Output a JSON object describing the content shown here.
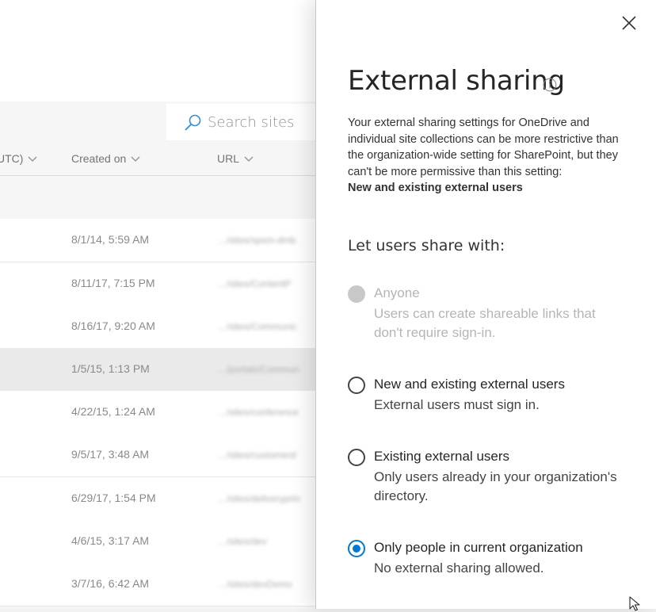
{
  "search": {
    "placeholder": "Search sites"
  },
  "table": {
    "columns": [
      {
        "label": "UTC)"
      },
      {
        "label": "Created on"
      },
      {
        "label": "URL"
      }
    ],
    "rows": [
      {
        "created": "8/1/14, 5:59 AM",
        "url": "…/sites/spsm-dmb"
      },
      {
        "created": "8/11/17, 7:15 PM",
        "url": "…/sites/ContentP"
      },
      {
        "created": "8/16/17, 9:20 AM",
        "url": "…/sites/Communic"
      },
      {
        "created": "1/5/15, 1:13 PM",
        "url": "…/portals/Commun"
      },
      {
        "created": "4/22/15, 1:24 AM",
        "url": "…/sites/conference"
      },
      {
        "created": "9/5/17, 3:48 AM",
        "url": "…/sites/customerd"
      },
      {
        "created": "6/29/17, 1:54 PM",
        "url": "…/sites/deliveryprin"
      },
      {
        "created": "4/6/15, 3:17 AM",
        "url": "…/sites/dev"
      },
      {
        "created": "3/7/16, 6:42 AM",
        "url": "…/sites/devDemo"
      }
    ]
  },
  "panel": {
    "title": "External sharing",
    "description": "Your external sharing settings for OneDrive and individual site collections can be more restrictive than the organization-wide setting for SharePoint, but they can't be more permissive than this setting:",
    "description_bold": "New and existing external users",
    "subhead": "Let users share with:",
    "options": [
      {
        "label": "Anyone",
        "desc": "Users can create shareable links that don't require sign-in."
      },
      {
        "label": "New and existing external users",
        "desc": "External users must sign in."
      },
      {
        "label": "Existing external users",
        "desc": "Only users already in your organization's directory."
      },
      {
        "label": "Only people in current organization",
        "desc": "No external sharing allowed."
      }
    ],
    "selected_option": "Only people in current organization",
    "disabled_option": "Anyone"
  },
  "colors": {
    "accent": "#0078d4",
    "disabled": "#c8c8c8"
  },
  "icons": [
    "search-icon",
    "chevron-down-icon",
    "close-icon",
    "info-icon",
    "mouse-cursor-icon"
  ]
}
